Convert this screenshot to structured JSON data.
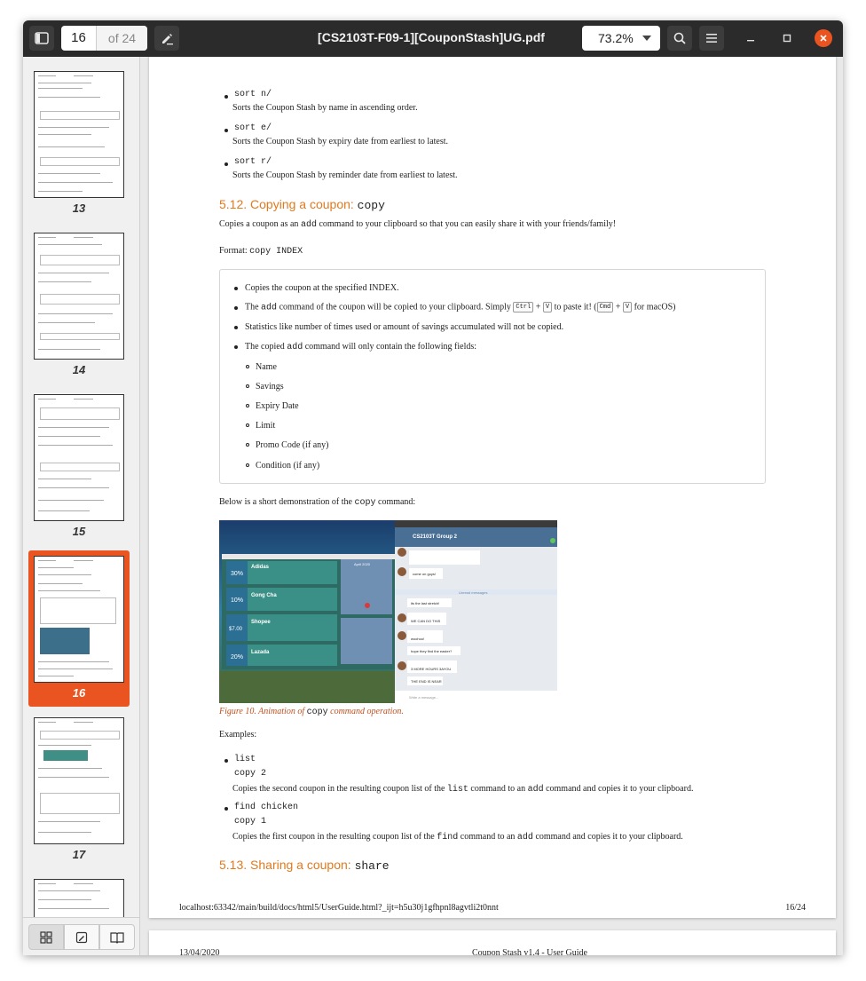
{
  "toolbar": {
    "page_current": "16",
    "page_total": "of 24",
    "title": "[CS2103T-F09-1][CouponStash]UG.pdf",
    "zoom": "73.2%"
  },
  "thumbnails": [
    {
      "label": "13"
    },
    {
      "label": "14"
    },
    {
      "label": "15"
    },
    {
      "label": "16"
    },
    {
      "label": "17"
    }
  ],
  "page": {
    "sort_items": [
      {
        "cmd": "sort n/",
        "desc": "Sorts the Coupon Stash by name in ascending order."
      },
      {
        "cmd": "sort e/",
        "desc": "Sorts the Coupon Stash by expiry date from earliest to latest."
      },
      {
        "cmd": "sort r/",
        "desc": "Sorts the Coupon Stash by reminder date from earliest to latest."
      }
    ],
    "copy_heading": "5.12. Copying a coupon:",
    "copy_heading_cmd": "copy",
    "copy_intro_a": "Copies a coupon as an",
    "copy_intro_cmd": "add",
    "copy_intro_b": "command to your clipboard so that you can easily share it with your friends/family!",
    "format_label": "Format:",
    "format_cmd": "copy INDEX",
    "note_items": {
      "i1": "Copies the coupon at the specified INDEX.",
      "i2_a": "The",
      "i2_cmd": "add",
      "i2_b": "command of the coupon will be copied to your clipboard. Simply",
      "kbd_ctrl": "Ctrl",
      "plus": "+",
      "kbd_v": "V",
      "i2_c": "to paste it! (",
      "kbd_cmd": "Cmd",
      "i2_d": "for macOS)",
      "i3": "Statistics like number of times used or amount of savings accumulated will not be copied.",
      "i4_a": "The copied",
      "i4_cmd": "add",
      "i4_b": "command will only contain the following fields:",
      "fields": [
        "Name",
        "Savings",
        "Expiry Date",
        "Limit",
        "Promo Code (if any)",
        "Condition (if any)"
      ]
    },
    "demo_a": "Below is a short demonstration of the",
    "demo_cmd": "copy",
    "demo_b": "command:",
    "caption_a": "Figure 10. Animation of",
    "caption_cmd": "copy",
    "caption_b": "command operation.",
    "examples_label": "Examples:",
    "examples": [
      {
        "cmd1": "list",
        "cmd2": "copy 2",
        "d_a": "Copies the second coupon in the resulting coupon list of the",
        "d_cmd1": "list",
        "d_b": "command to an",
        "d_cmd2": "add",
        "d_c": "command and copies it to your clipboard."
      },
      {
        "cmd1": "find chicken",
        "cmd2": "copy 1",
        "d_a": "Copies the first coupon in the resulting coupon list of the",
        "d_cmd1": "find",
        "d_b": "command to an",
        "d_cmd2": "add",
        "d_c": "command and copies it to your clipboard."
      }
    ],
    "share_heading": "5.13. Sharing a coupon:",
    "share_heading_cmd": "share",
    "footer_url": "localhost:63342/main/build/docs/html5/UserGuide.html?_ijt=h5u30j1gfhpnl8agvtli2t0nnt",
    "footer_page": "16/24"
  },
  "next_page": {
    "date": "13/04/2020",
    "title": "Coupon Stash v1.4 - User Guide"
  },
  "demo_image": {
    "chat_title": "CS2103T Group 2",
    "calendar_title": "April 2020",
    "coupons": [
      {
        "pct": "30%",
        "name": "Adidas"
      },
      {
        "pct": "10%",
        "name": "Gong Cha"
      },
      {
        "pct": "$7.00",
        "name": "Shopee"
      },
      {
        "pct": "20%",
        "name": "Lazada"
      }
    ],
    "messages": [
      "come on guys!",
      "its the last stretch!",
      "WE CAN DO THIS",
      "woohoo!",
      "hope they find the easter?",
      "3 MORE HOURS 3AYOU",
      "THE END IS NEAR",
      "Unread messages",
      "Write a message..."
    ]
  }
}
